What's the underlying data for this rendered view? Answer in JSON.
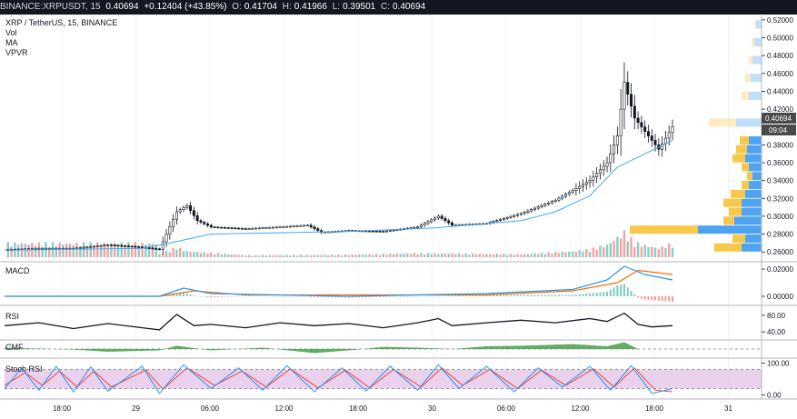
{
  "header": {
    "symbol": "BINANCE:XRPUSDT, 15",
    "last": "0.40694",
    "change": "+0.12404 (+43.85%)",
    "o_label": "O:",
    "o": "0.41704",
    "h_label": "H:",
    "h": "0.41966",
    "l_label": "L:",
    "l": "0.39501",
    "c_label": "C:",
    "c": "0.40694"
  },
  "legend": {
    "title": "XRP / TetherUS, 15, BINANCE",
    "items": [
      "Vol",
      "MA",
      "VPVR"
    ]
  },
  "panels": {
    "macd": "MACD",
    "rsi": "RSI",
    "cmf": "CMF",
    "stoch": "Stoch RSI"
  },
  "price_badge": {
    "value": "0.40694",
    "countdown": "09:04"
  },
  "colors": {
    "background": "#ffffff",
    "topbar": "#131722",
    "up": "#26a69a",
    "down": "#ef5350",
    "ma": "#42a5f5",
    "vpvr_up": "#4ea4f0",
    "vpvr_down": "#f7c84a",
    "macd_line": "#2196f3",
    "signal_line": "#ff6d00",
    "rsi_line": "#131722",
    "cmf_fill": "#43a047",
    "stoch_band": "#e1bee7",
    "stoch_k": "#2196f3",
    "stoch_d": "#f44336"
  },
  "chart_data": {
    "type": "candlestick",
    "x_ticks": [
      "18:00",
      "29",
      "06:00",
      "12:00",
      "18:00",
      "30",
      "06:00",
      "12:00",
      "18:00",
      "31"
    ],
    "price_axis": {
      "ticks": [
        "0.52000",
        "0.50000",
        "0.48000",
        "0.46000",
        "0.44000",
        "0.42000",
        "0.38000",
        "0.36000",
        "0.34000",
        "0.32000",
        "0.30000",
        "0.28000",
        "0.26000"
      ],
      "ylim": [
        0.25,
        0.525
      ]
    },
    "macd_axis": {
      "ticks": [
        "0.02000",
        "0.00000"
      ],
      "ylim": [
        -0.004,
        0.024
      ]
    },
    "rsi_axis": {
      "ticks": [
        "80.00",
        "40.00"
      ],
      "ylim": [
        25,
        95
      ]
    },
    "stoch_axis": {
      "ticks": [
        "100.00",
        "0.00"
      ],
      "ylim": [
        -10,
        110
      ]
    },
    "close_path": [
      [
        0,
        0.2625
      ],
      [
        10,
        0.264
      ],
      [
        20,
        0.264
      ],
      [
        30,
        0.268
      ],
      [
        38,
        0.266
      ],
      [
        45,
        0.263
      ],
      [
        50,
        0.305
      ],
      [
        53,
        0.312
      ],
      [
        56,
        0.295
      ],
      [
        60,
        0.288
      ],
      [
        70,
        0.286
      ],
      [
        80,
        0.288
      ],
      [
        88,
        0.29
      ],
      [
        92,
        0.282
      ],
      [
        100,
        0.284
      ],
      [
        110,
        0.283
      ],
      [
        120,
        0.288
      ],
      [
        126,
        0.3
      ],
      [
        130,
        0.29
      ],
      [
        140,
        0.292
      ],
      [
        150,
        0.303
      ],
      [
        160,
        0.318
      ],
      [
        170,
        0.34
      ],
      [
        175,
        0.36
      ],
      [
        178,
        0.39
      ],
      [
        180,
        0.45
      ],
      [
        183,
        0.41
      ],
      [
        186,
        0.395
      ],
      [
        190,
        0.375
      ],
      [
        194,
        0.4
      ]
    ],
    "ma_path": [
      [
        0,
        0.262
      ],
      [
        40,
        0.264
      ],
      [
        48,
        0.27
      ],
      [
        60,
        0.28
      ],
      [
        100,
        0.283
      ],
      [
        125,
        0.287
      ],
      [
        150,
        0.295
      ],
      [
        160,
        0.305
      ],
      [
        170,
        0.323
      ],
      [
        178,
        0.355
      ],
      [
        186,
        0.37
      ],
      [
        194,
        0.385
      ]
    ],
    "volume": [
      [
        45,
        0.6
      ],
      [
        50,
        2.0
      ],
      [
        53,
        1.2
      ],
      [
        70,
        0.4
      ],
      [
        100,
        0.5
      ],
      [
        120,
        0.8
      ],
      [
        150,
        0.6
      ],
      [
        160,
        1.0
      ],
      [
        165,
        1.2
      ],
      [
        170,
        1.6
      ],
      [
        175,
        2.5
      ],
      [
        178,
        4.0
      ],
      [
        180,
        5.0
      ],
      [
        183,
        3.0
      ],
      [
        186,
        2.4
      ],
      [
        190,
        1.8
      ],
      [
        194,
        2.8
      ]
    ],
    "vpvr": [
      {
        "price": 0.265,
        "up": 22,
        "down": 30
      },
      {
        "price": 0.275,
        "up": 18,
        "down": 14
      },
      {
        "price": 0.285,
        "up": 70,
        "down": 75
      },
      {
        "price": 0.295,
        "up": 30,
        "down": 12
      },
      {
        "price": 0.305,
        "up": 22,
        "down": 14
      },
      {
        "price": 0.315,
        "up": 22,
        "down": 20
      },
      {
        "price": 0.325,
        "up": 18,
        "down": 16
      },
      {
        "price": 0.335,
        "up": 14,
        "down": 8
      },
      {
        "price": 0.345,
        "up": 10,
        "down": 6
      },
      {
        "price": 0.355,
        "up": 14,
        "down": 8
      },
      {
        "price": 0.365,
        "up": 18,
        "down": 14
      },
      {
        "price": 0.375,
        "up": 16,
        "down": 12
      },
      {
        "price": 0.385,
        "up": 14,
        "down": 10
      },
      {
        "price": 0.405,
        "up": 28,
        "down": 30
      },
      {
        "price": 0.435,
        "up": 14,
        "down": 8
      },
      {
        "price": 0.455,
        "up": 12,
        "down": 6
      },
      {
        "price": 0.475,
        "up": 10,
        "down": 4
      },
      {
        "price": 0.495,
        "up": 8,
        "down": 3
      },
      {
        "price": 0.515,
        "up": 6,
        "down": 2
      }
    ],
    "macd": [
      [
        0,
        0.0
      ],
      [
        45,
        0.0
      ],
      [
        52,
        0.006
      ],
      [
        60,
        0.002
      ],
      [
        100,
        0.0
      ],
      [
        140,
        0.002
      ],
      [
        165,
        0.005
      ],
      [
        175,
        0.012
      ],
      [
        180,
        0.022
      ],
      [
        186,
        0.016
      ],
      [
        194,
        0.012
      ]
    ],
    "signal": [
      [
        0,
        0.0
      ],
      [
        45,
        0.0
      ],
      [
        55,
        0.004
      ],
      [
        70,
        0.001
      ],
      [
        140,
        0.001
      ],
      [
        165,
        0.004
      ],
      [
        178,
        0.01
      ],
      [
        184,
        0.019
      ],
      [
        194,
        0.016
      ]
    ],
    "rsi": [
      [
        0,
        55
      ],
      [
        10,
        62
      ],
      [
        20,
        48
      ],
      [
        30,
        60
      ],
      [
        40,
        50
      ],
      [
        45,
        45
      ],
      [
        50,
        82
      ],
      [
        55,
        55
      ],
      [
        60,
        58
      ],
      [
        70,
        50
      ],
      [
        80,
        62
      ],
      [
        90,
        55
      ],
      [
        100,
        60
      ],
      [
        110,
        50
      ],
      [
        120,
        62
      ],
      [
        126,
        72
      ],
      [
        130,
        55
      ],
      [
        140,
        62
      ],
      [
        150,
        68
      ],
      [
        160,
        62
      ],
      [
        170,
        72
      ],
      [
        175,
        65
      ],
      [
        180,
        85
      ],
      [
        184,
        58
      ],
      [
        188,
        52
      ],
      [
        194,
        55
      ]
    ],
    "cmf": [
      [
        0,
        0.05
      ],
      [
        20,
        -0.02
      ],
      [
        30,
        -0.1
      ],
      [
        45,
        -0.05
      ],
      [
        50,
        0.12
      ],
      [
        60,
        -0.05
      ],
      [
        75,
        0.05
      ],
      [
        90,
        -0.15
      ],
      [
        100,
        -0.05
      ],
      [
        110,
        0.08
      ],
      [
        120,
        0.05
      ],
      [
        130,
        0.0
      ],
      [
        140,
        0.1
      ],
      [
        150,
        0.12
      ],
      [
        165,
        0.18
      ],
      [
        175,
        0.1
      ],
      [
        180,
        0.25
      ],
      [
        184,
        0.0
      ],
      [
        194,
        0.0
      ]
    ],
    "stoch_k": [
      [
        0,
        20
      ],
      [
        5,
        85
      ],
      [
        10,
        15
      ],
      [
        15,
        90
      ],
      [
        20,
        10
      ],
      [
        25,
        88
      ],
      [
        30,
        12
      ],
      [
        40,
        90
      ],
      [
        45,
        5
      ],
      [
        52,
        95
      ],
      [
        60,
        20
      ],
      [
        68,
        85
      ],
      [
        75,
        15
      ],
      [
        82,
        92
      ],
      [
        90,
        10
      ],
      [
        98,
        85
      ],
      [
        105,
        12
      ],
      [
        112,
        90
      ],
      [
        120,
        15
      ],
      [
        126,
        95
      ],
      [
        132,
        20
      ],
      [
        140,
        90
      ],
      [
        148,
        10
      ],
      [
        155,
        85
      ],
      [
        162,
        25
      ],
      [
        170,
        90
      ],
      [
        176,
        15
      ],
      [
        182,
        92
      ],
      [
        188,
        5
      ],
      [
        194,
        20
      ]
    ],
    "stoch_d": [
      [
        0,
        30
      ],
      [
        6,
        70
      ],
      [
        11,
        30
      ],
      [
        16,
        75
      ],
      [
        21,
        25
      ],
      [
        26,
        75
      ],
      [
        31,
        25
      ],
      [
        41,
        78
      ],
      [
        46,
        18
      ],
      [
        53,
        85
      ],
      [
        61,
        30
      ],
      [
        69,
        75
      ],
      [
        76,
        25
      ],
      [
        83,
        82
      ],
      [
        91,
        22
      ],
      [
        99,
        78
      ],
      [
        106,
        22
      ],
      [
        113,
        80
      ],
      [
        121,
        25
      ],
      [
        127,
        85
      ],
      [
        133,
        30
      ],
      [
        141,
        80
      ],
      [
        149,
        20
      ],
      [
        156,
        78
      ],
      [
        163,
        30
      ],
      [
        171,
        82
      ],
      [
        177,
        25
      ],
      [
        183,
        85
      ],
      [
        189,
        15
      ],
      [
        194,
        10
      ]
    ]
  }
}
